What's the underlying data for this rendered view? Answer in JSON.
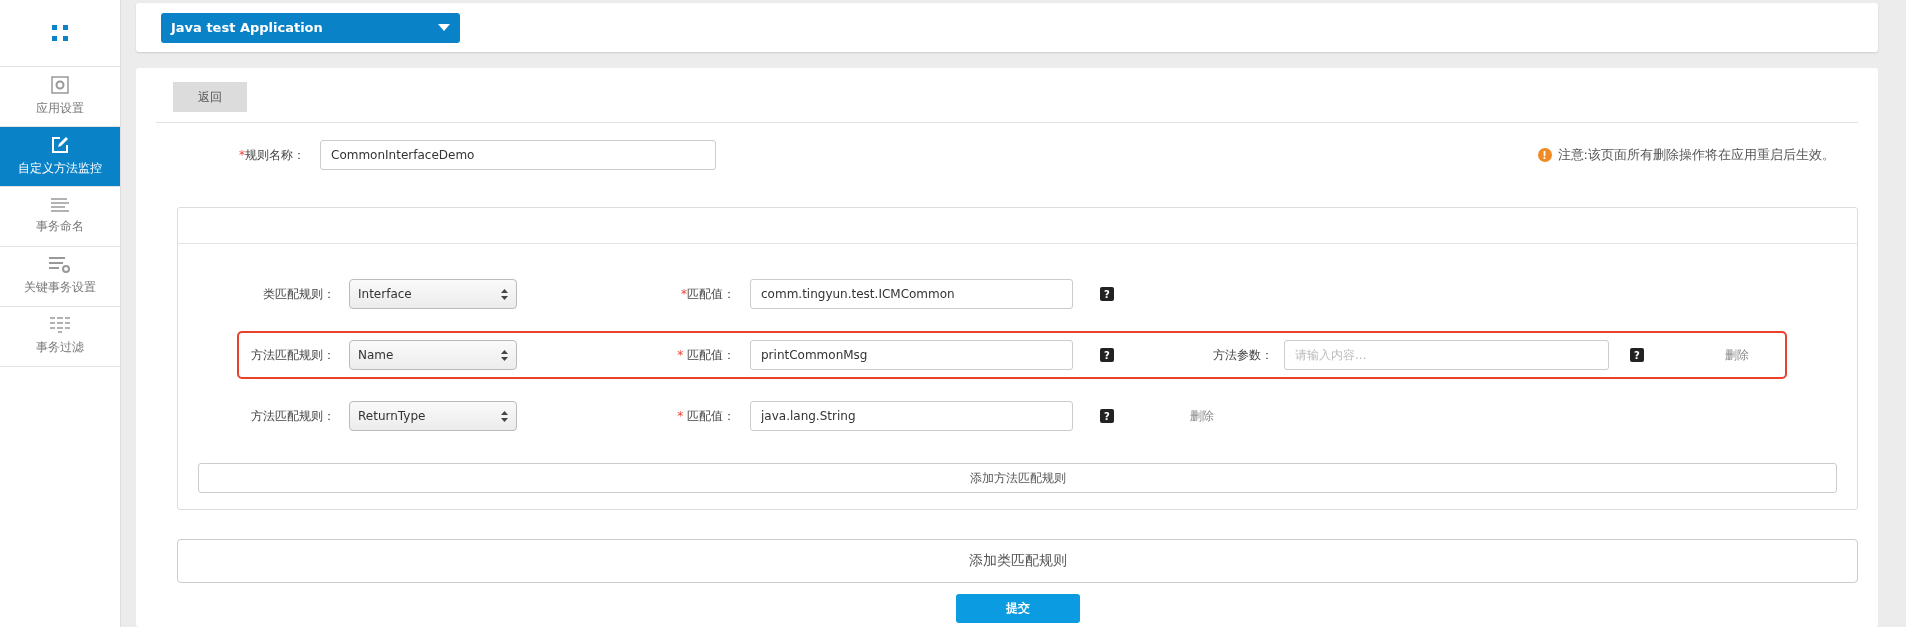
{
  "app_selector": {
    "value": "Java test Application"
  },
  "sidebar": {
    "items": [
      {
        "kind": "settings",
        "label": "应用设置",
        "selected": false
      },
      {
        "kind": "edit",
        "label": "自定义方法监控",
        "selected": true
      },
      {
        "kind": "lines",
        "label": "事务命名",
        "selected": false
      },
      {
        "kind": "lines-gear",
        "label": "关键事务设置",
        "selected": false
      },
      {
        "kind": "filter",
        "label": "事务过滤",
        "selected": false
      }
    ]
  },
  "back_button": "返回",
  "rule_name": {
    "required_mark": "*",
    "label": "规则名称：",
    "value": "CommonInterfaceDemo"
  },
  "notice": {
    "icon": "!",
    "text": "注意:该页面所有删除操作将在应用重启后生效。"
  },
  "rules": [
    {
      "label": "类匹配规则：",
      "select": "Interface",
      "required_mark": "*",
      "value_label": "匹配值：",
      "value": "comm.tingyun.test.ICMCommon",
      "help": "?",
      "highlighted": false
    },
    {
      "label": "方法匹配规则：",
      "select": "Name",
      "required_mark": "* ",
      "value_label": "匹配值：",
      "value": "printCommonMsg",
      "help": "?",
      "params_label": "方法参数：",
      "params_placeholder": "请输入内容...",
      "params_help": "?",
      "delete": "删除",
      "highlighted": true
    },
    {
      "label": "方法匹配规则：",
      "select": "ReturnType",
      "required_mark": "* ",
      "value_label": "匹配值：",
      "value": "java.lang.String",
      "help": "?",
      "delete": "删除",
      "highlighted": false
    }
  ],
  "add_method_rule": "添加方法匹配规则",
  "add_class_rule": "添加类匹配规则",
  "submit": "提交"
}
